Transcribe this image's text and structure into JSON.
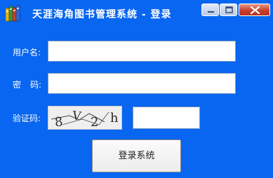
{
  "window": {
    "title": "天涯海角图书管理系统 - 登录"
  },
  "form": {
    "username_label": "用户名:",
    "username_value": "",
    "password_label_part1": "密",
    "password_label_part2": "码:",
    "password_value": "",
    "captcha_label": "验证码:",
    "captcha_text": [
      "8",
      "V",
      "2",
      "h"
    ],
    "captcha_value": ""
  },
  "buttons": {
    "login_label": "登录系统"
  },
  "colors": {
    "window_bg": "#0866f0",
    "label_text": "#ffffff",
    "close_button": "#c8402c"
  },
  "icons": {
    "app": "books-icon",
    "minimize": "minimize-icon",
    "maximize": "maximize-icon",
    "close": "close-icon"
  }
}
